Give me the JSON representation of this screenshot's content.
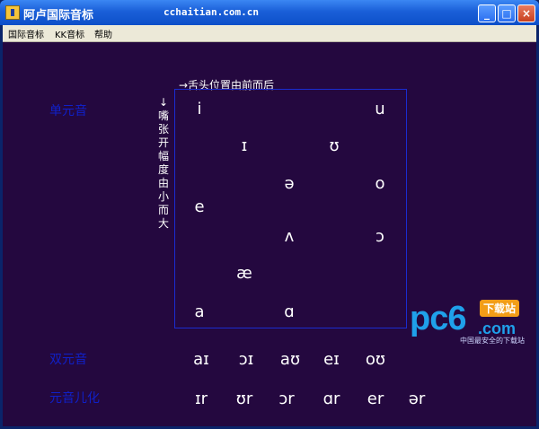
{
  "window": {
    "title": "阿卢国际音标",
    "url": "cchaitian.com.cn",
    "minimize": "_",
    "maximize": "□",
    "close": "×"
  },
  "menu": [
    "国际音标",
    "KK音标",
    "帮助"
  ],
  "labels": {
    "monophthong": "单元音",
    "diphthong": "双元音",
    "r_colored": "元音儿化"
  },
  "axes": {
    "tongue": "→舌头位置由前而后",
    "mouth": "↓嘴张开幅度由小而大"
  },
  "vowels": [
    "i",
    "u",
    "ɪ",
    "ʊ",
    "ə",
    "o",
    "e",
    "ʌ",
    "ɔ",
    "æ",
    "a",
    "ɑ"
  ],
  "diphthongs": [
    "aɪ",
    "ɔɪ",
    "aʊ",
    "eɪ",
    "oʊ"
  ],
  "r_vowels": [
    "ɪr",
    "ʊr",
    "ɔr",
    "ɑr",
    "er",
    "ər"
  ],
  "watermark": {
    "brand": "pc6",
    "suffix": ".com",
    "badge": "下载站",
    "tagline": "中国最安全的下载站"
  }
}
